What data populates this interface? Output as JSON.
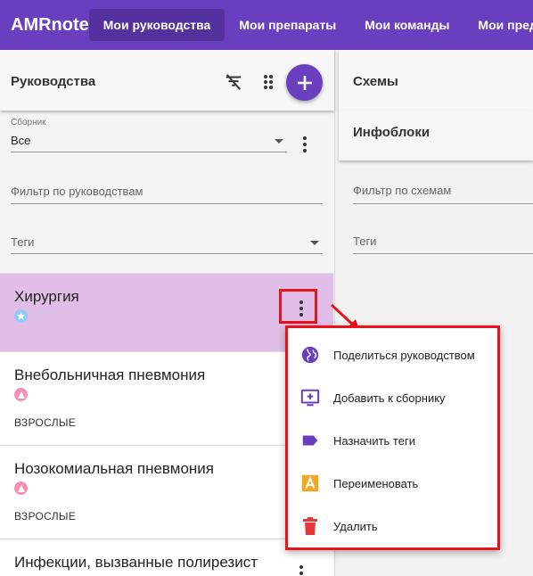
{
  "app": {
    "brand": "AMRnote",
    "nav": [
      {
        "label": "Мои руководства",
        "active": true
      },
      {
        "label": "Мои препараты",
        "active": false
      },
      {
        "label": "Мои команды",
        "active": false
      },
      {
        "label": "Мои предл",
        "active": false
      }
    ],
    "accent": "#6a3fbf"
  },
  "left": {
    "title": "Руководства",
    "collection": {
      "label": "Сборник",
      "value": "Все"
    },
    "filter_placeholder": "Фильтр по руководствам",
    "tags_placeholder": "Теги",
    "items": [
      {
        "name": "Хирургия",
        "badge": "star",
        "tag": "",
        "selected": true
      },
      {
        "name": "Внебольничная пневмония",
        "badge": "triangle",
        "tag": "ВЗРОСЛЫЕ",
        "selected": false
      },
      {
        "name": "Нозокомиальная пневмония",
        "badge": "triangle",
        "tag": "ВЗРОСЛЫЕ",
        "selected": false
      },
      {
        "name": "Инфекции, вызванные полирезист",
        "badge": "",
        "tag": "",
        "selected": false
      }
    ]
  },
  "right": {
    "schemes_title": "Схемы",
    "infoblocks_title": "Инфоблоки",
    "filter_placeholder": "Фильтр по схемам",
    "tags_placeholder": "Теги"
  },
  "menu": {
    "items": [
      {
        "label": "Поделиться руководством",
        "icon": "globe-icon",
        "color": "#6a3fbf"
      },
      {
        "label": "Добавить к сборнику",
        "icon": "add-to-queue-icon",
        "color": "#6a3fbf"
      },
      {
        "label": "Назначить теги",
        "icon": "label-icon",
        "color": "#6a3fbf"
      },
      {
        "label": "Переименовать",
        "icon": "rename-icon",
        "color": "#f5a623"
      },
      {
        "label": "Удалить",
        "icon": "trash-icon",
        "color": "#e53935"
      }
    ]
  },
  "colors": {
    "highlight": "#e8141a",
    "selected_card": "#e1bee7"
  }
}
